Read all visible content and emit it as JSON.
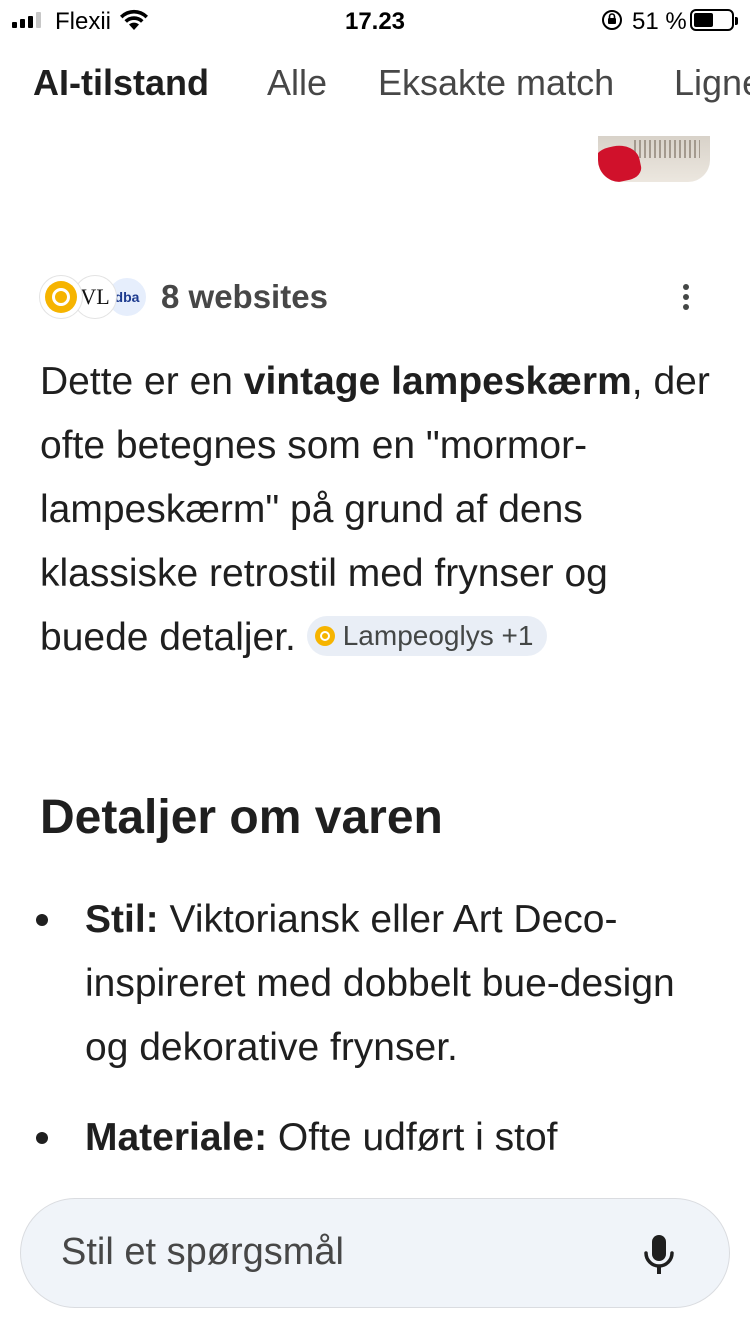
{
  "status_bar": {
    "carrier": "Flexii",
    "time": "17.23",
    "battery_percent": "51 %"
  },
  "tabs": [
    {
      "label": "AI-tilstand",
      "active": true
    },
    {
      "label": "Alle",
      "active": false
    },
    {
      "label": "Eksakte match",
      "active": false
    },
    {
      "label": "Lignende",
      "active": false
    }
  ],
  "sources": {
    "icons": [
      "lampeoglys-logo",
      "vl-logo",
      "dba-logo"
    ],
    "icon_text_vl": "VL",
    "icon_text_dba": "dba",
    "count_label": "8 websites"
  },
  "answer": {
    "text_1": "Dette er en ",
    "bold_1": "vintage lampeskærm",
    "text_2": ", der ofte betegnes som en \"mormor-lampeskærm\" på grund af dens klassiske retrostil med frynser og buede detaljer.",
    "chip_label": "Lampeoglys +1"
  },
  "details": {
    "heading": "Detaljer om varen",
    "items": [
      {
        "label": "Stil:",
        "text": " Viktoriansk eller Art Deco-inspireret med dobbelt bue-design og dekorative frynser."
      },
      {
        "label": "Materiale:",
        "text": " Ofte udført i stof"
      }
    ]
  },
  "ask": {
    "placeholder": "Stil et spørgsmål"
  },
  "colors": {
    "text": "#1f1f1f",
    "muted": "#474747",
    "chip_bg": "#e9eef6",
    "input_bg": "#f0f4f9",
    "source_yellow": "#f6b400"
  }
}
